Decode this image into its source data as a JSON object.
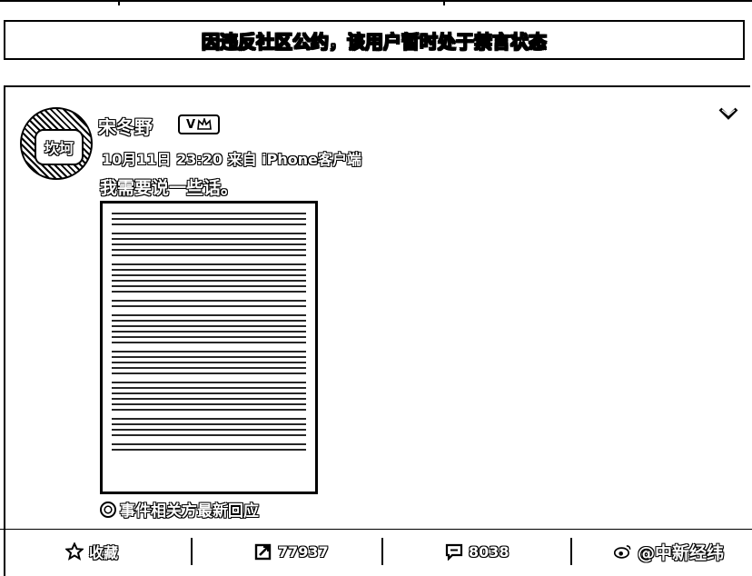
{
  "banner": {
    "text": "因违反社区公约，该用户暂时处于禁言状态"
  },
  "post": {
    "avatar_label": "坎坷",
    "username": "宋冬野",
    "badge_label": "V",
    "meta": "10月11日 23:20 来自 iPhone客户端",
    "text": "我需要说一些话。",
    "event_link": "事件相关方最新回应"
  },
  "actions": {
    "favorite": {
      "icon": "star-icon",
      "label": "收藏"
    },
    "repost": {
      "icon": "repost-icon",
      "count": "77937"
    },
    "comment": {
      "icon": "comment-icon",
      "count": "8038"
    },
    "watermark": "@中新经纬"
  }
}
